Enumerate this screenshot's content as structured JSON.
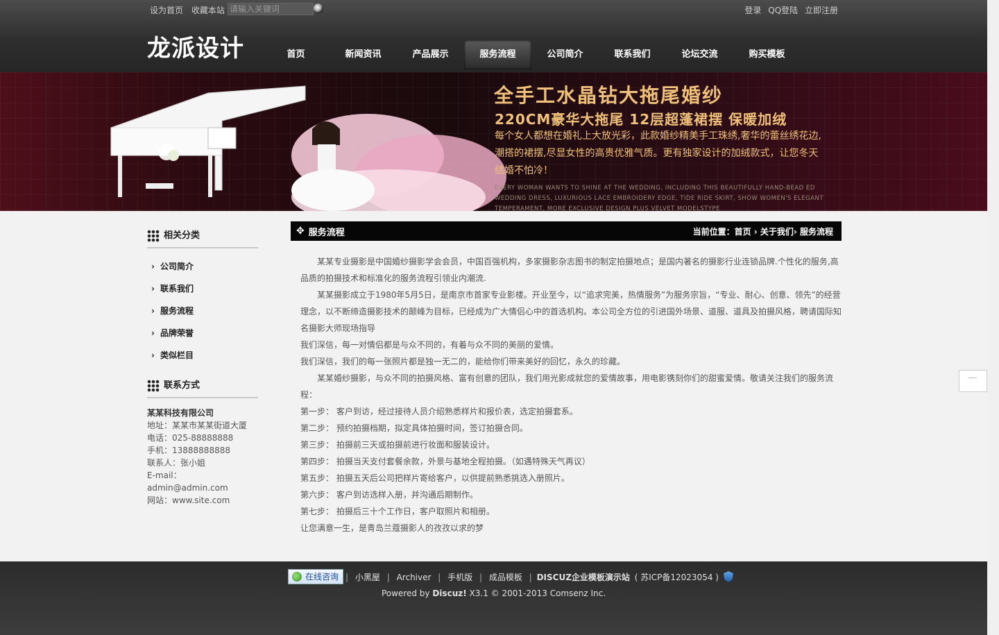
{
  "topbar": {
    "set_home": "设为首页",
    "bookmark": "收藏本站",
    "search_placeholder": "请输入关键词",
    "login": "登录",
    "qq_login": "QQ登陆",
    "register": "立即注册"
  },
  "logo": "龙派设计",
  "nav": {
    "items": [
      {
        "label": "首页"
      },
      {
        "label": "新闻资讯"
      },
      {
        "label": "产品展示"
      },
      {
        "label": "服务流程"
      },
      {
        "label": "公司简介"
      },
      {
        "label": "联系我们"
      },
      {
        "label": "论坛交流"
      },
      {
        "label": "购买模板"
      }
    ],
    "active": "服务流程"
  },
  "banner": {
    "title": "全手工水晶钻大拖尾婚纱",
    "subtitle": "220CM豪华大拖尾 12层超蓬裙摆 保暖加绒",
    "desc": "每个女人都想在婚礼上大放光彩，此款婚纱精美手工珠绣,奢华的蕾丝绣花边,潮搭的裙摆,尽显女性的高贵优雅气质。更有独家设计的加绒款式，让您冬天结婚不怕冷！",
    "desc_en": "EVERY WOMAN WANTS TO SHINE AT THE WEDDING, INCLUDING THIS BEAUTIFULLY HAND-BEAD ED WEDDING DRESS, LUXURIOUS LACE EMBROIDERY EDGE, TIDE RIDE SKIRT, SHOW WOMEN'S ELEGANT TEMPERAMENT, MORE EXCLUSIVE DESIGN PLUS VELVET MODELSTYPE"
  },
  "sidebar": {
    "category_title": "相关分类",
    "categories": [
      {
        "label": "公司简介"
      },
      {
        "label": "联系我们"
      },
      {
        "label": "服务流程"
      },
      {
        "label": "品牌荣誉"
      },
      {
        "label": "类似栏目"
      }
    ],
    "contact_title": "联系方式",
    "contact": {
      "company": "某某科技有限公司",
      "address": "地址：某某市某某街道大厦",
      "phone": "电话：025-88888888",
      "mobile": "手机：13888888888",
      "person": "联系人：张小姐",
      "email": "E-mail：admin@admin.com",
      "site": "网站：www.site.com"
    }
  },
  "content": {
    "title": "服务流程",
    "breadcrumb": "当前位置：首页 › 关于我们› 服务流程",
    "paragraphs": [
      "某某专业摄影是中国婚纱摄影学会会员，中国百强机构，多家摄影杂志图书的制定拍摄地点；是国内著名的摄影行业连锁品牌.个性化的服务,高品质的拍摄技术和标准化的服务流程引领业内潮流.",
      "某某摄影成立于1980年5月5日，是南京市首家专业影楼。开业至今，以“追求完美，热情服务”为服务宗旨，“专业、耐心、创意、领先”的经营理念，以不断缔造摄影技术的颠峰为目标，已经成为广大情侣心中的首选机构。本公司全方位的引进国外场景、道服、道具及拍摄风格，聘请国际知名摄影大师现场指导",
      "我们深信，每一对情侣都是与众不同的，有着与众不同的美丽的爱情。",
      "我们深信，我们的每一张照片都是独一无二的，能给你们带来美好的回忆，永久的珍藏。",
      "某某婚纱摄影，与众不同的拍摄风格、富有创意的团队，我们用光影成就您的爱情故事，用电影镌刻你们的甜蜜爱情。敬请关注我们的服务流程：",
      "第一步： 客户到访，经过接待人员介绍熟悉样片和报价表，选定拍摄套系。",
      "第二步： 预约拍摄档期，拟定具体拍摄时间，签订拍摄合同。",
      "第三步： 拍摄前三天或拍摄前进行妆面和服装设计。",
      "第四步： 拍摄当天支付套餐余款，外景与基地全程拍摄。（如遇特殊天气再议）",
      "第五步： 拍摄五天后公司把样片寄给客户，以供提前熟悉挑选入册照片。",
      "第六步： 客户到访选样入册，并沟通后期制作。",
      "第七步： 拍摄后三十个工作日，客户取照片和相册。",
      "让您满意一生，是青岛兰蔻摄影人的孜孜以求的梦"
    ]
  },
  "footer": {
    "online": "在线咨询",
    "links": [
      "小黑屋",
      "Archiver",
      "手机版",
      "成品模板"
    ],
    "site_name": "DISCUZ企业模板演示站",
    "icp": "( 苏ICP备12023054 )",
    "powered_prefix": "Powered by",
    "powered_brand": "Discuz!",
    "powered_suffix": "X3.1 © 2001-2013 Comsenz Inc."
  }
}
